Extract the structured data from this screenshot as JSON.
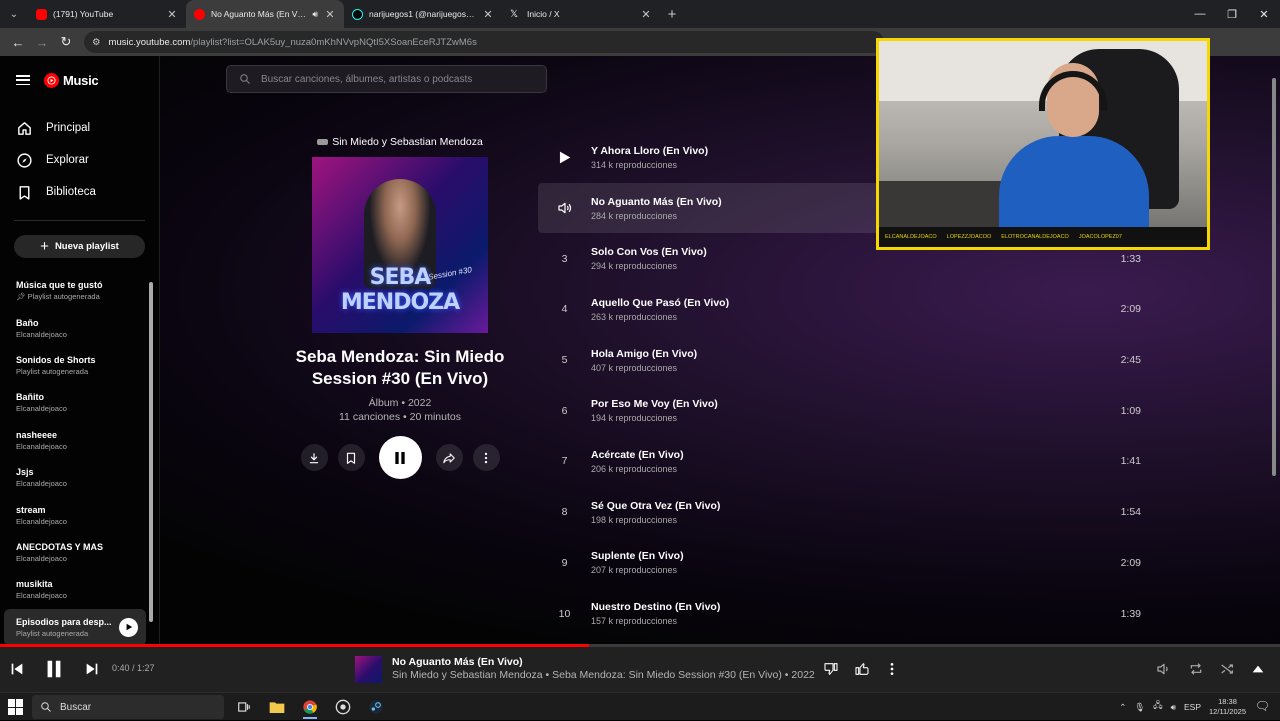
{
  "browser": {
    "tabs": [
      {
        "title": "(1791) YouTube",
        "color": "#ff0000",
        "active": false
      },
      {
        "title": "No Aguanto Más (En Vivo)",
        "color": "#ff0000",
        "active": true
      },
      {
        "title": "narijuegos1 (@narijuegos1) | Ti",
        "color": "#25f4ee",
        "active": false
      },
      {
        "title": "Inicio / X",
        "color": "#ffffff",
        "active": false
      }
    ],
    "url_host": "music.youtube.com",
    "url_path": "/playlist?list=OLAK5uy_nuza0mKhNVvpNQtI5XSoanEceRJTZwM6s"
  },
  "ytmusic": {
    "logo_text": "Music",
    "nav": [
      {
        "label": "Principal",
        "icon": "home-icon"
      },
      {
        "label": "Explorar",
        "icon": "explore-icon"
      },
      {
        "label": "Biblioteca",
        "icon": "library-icon"
      }
    ],
    "new_playlist_label": "Nueva playlist",
    "playlists": [
      {
        "name": "Música que te gustó",
        "sub": "Playlist autogenerada"
      },
      {
        "name": "Baño",
        "sub": "Elcanaldejoaco"
      },
      {
        "name": "Sonidos de Shorts",
        "sub": "Playlist autogenerada"
      },
      {
        "name": "Bañito",
        "sub": "Elcanaldejoaco"
      },
      {
        "name": "nasheeee",
        "sub": "Elcanaldejoaco"
      },
      {
        "name": "Jsjs",
        "sub": "Elcanaldejoaco"
      },
      {
        "name": "stream",
        "sub": "Elcanaldejoaco"
      },
      {
        "name": "ANECDOTAS Y MAS",
        "sub": "Elcanaldejoaco"
      },
      {
        "name": "musikita",
        "sub": "Elcanaldejoaco"
      },
      {
        "name": "Episodios para desp...",
        "sub": "Playlist autogenerada"
      }
    ],
    "search_placeholder": "Buscar canciones, álbumes, artistas o podcasts",
    "album": {
      "artists": "Sin Miedo y Sebastian Mendoza",
      "cover_text": "SEBA MENDOZA",
      "cover_session": "Session #30",
      "title": "Seba Mendoza: Sin Miedo Session #30 (En Vivo)",
      "meta1": "Álbum • 2022",
      "meta2": "11 canciones • 20 minutos"
    },
    "tracks": [
      {
        "num": "1",
        "title": "Y Ahora Lloro (En Vivo)",
        "plays": "314 k reproducciones",
        "duration": ""
      },
      {
        "num": "2",
        "title": "No Aguanto Más (En Vivo)",
        "plays": "284 k reproducciones",
        "duration": ""
      },
      {
        "num": "3",
        "title": "Solo Con Vos (En Vivo)",
        "plays": "294 k reproducciones",
        "duration": "1:33"
      },
      {
        "num": "4",
        "title": "Aquello Que Pasó (En Vivo)",
        "plays": "263 k reproducciones",
        "duration": "2:09"
      },
      {
        "num": "5",
        "title": "Hola Amigo (En Vivo)",
        "plays": "407 k reproducciones",
        "duration": "2:45"
      },
      {
        "num": "6",
        "title": "Por Eso Me Voy (En Vivo)",
        "plays": "194 k reproducciones",
        "duration": "1:09"
      },
      {
        "num": "7",
        "title": "Acércate (En Vivo)",
        "plays": "206 k reproducciones",
        "duration": "1:41"
      },
      {
        "num": "8",
        "title": "Sé Que Otra Vez (En Vivo)",
        "plays": "198 k reproducciones",
        "duration": "1:54"
      },
      {
        "num": "9",
        "title": "Suplente (En Vivo)",
        "plays": "207 k reproducciones",
        "duration": "2:09"
      },
      {
        "num": "10",
        "title": "Nuestro Destino (En Vivo)",
        "plays": "157 k reproducciones",
        "duration": "1:39"
      }
    ],
    "player": {
      "time": "0:40 / 1:27",
      "progress": 0.46,
      "title": "No Aguanto Más (En Vivo)",
      "subtitle": "Sin Miedo y Sebastian Mendoza • Seba Mendoza: Sin Miedo Session #30 (En Vivo) • 2022"
    }
  },
  "webcam": {
    "ticker": [
      "ELCANALDEJOACO",
      "LOPEZZJOACOO",
      "ELOTROCANALDEJOACO",
      "JOACOLOPEZ07"
    ]
  },
  "taskbar": {
    "search_label": "Buscar",
    "lang": "ESP",
    "time": "18:38",
    "date": "12/11/2025"
  }
}
